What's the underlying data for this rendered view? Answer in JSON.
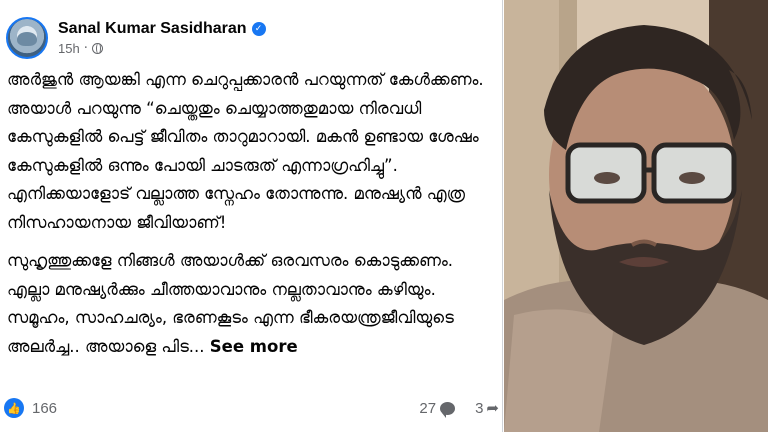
{
  "post": {
    "author": "Sanal Kumar Sasidharan",
    "timestamp": "15h",
    "separator": "·",
    "paragraphs": [
      "അർജുൻ ആയങ്കി എന്ന ചെറുപ്പക്കാരൻ പറയുന്നത് കേൾക്കണം. അയാൾ പറയുന്നു “ചെയ്തതും ചെയ്യാത്തതുമായ നിരവധി കേസുകളിൽ പെട്ട് ജീവിതം താറുമാറായി. മകൻ ഉണ്ടായ ശേഷം കേസുകളിൽ ഒന്നും പോയി ചാടരുത് എന്നാഗ്രഹിച്ചു”. എനിക്കയാളോട് വല്ലാത്ത സ്നേഹം തോന്നുന്നു. മനുഷ്യൻ എത്ര നിസഹായനായ ജീവിയാണ്!",
      "സുഹൃത്തുക്കളേ നിങ്ങൾ അയാൾക്ക് ഒരവസരം കൊടുക്കണം. എല്ലാ മനുഷ്യർക്കും ചീത്തയാവാനും നല്ലതാവാനും കഴിയും. സമൂഹം, സാഹചര്യം, ഭരണകൂടം എന്ന ഭീകരയന്ത്രജീവിയുടെ അലർച്ച.. അയാളെ പിട..."
    ],
    "see_more": "See more",
    "reaction_count": "166",
    "comment_count": "27",
    "share_count": "3",
    "icons": {
      "verified": "verified-badge-icon",
      "privacy": "globe-icon",
      "reaction": "like-icon",
      "comments": "comment-icon",
      "shares": "share-icon"
    },
    "colors": {
      "accent": "#1877f2",
      "secondary_text": "#65676b"
    }
  },
  "photo": {
    "subject": "portrait-photo"
  }
}
